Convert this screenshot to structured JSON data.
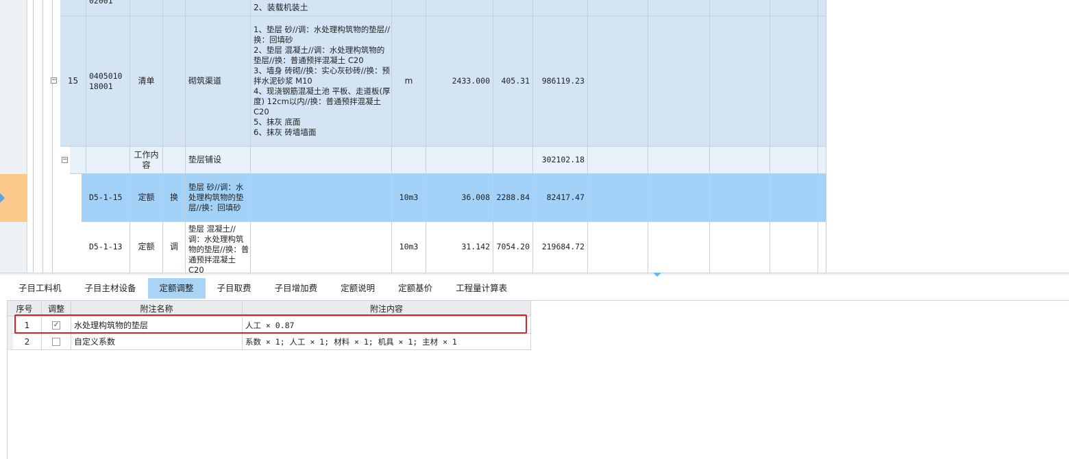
{
  "colors": {
    "row_list": "#d4e4f4",
    "row_work": "#e8f2fb",
    "row_selected": "#a3d2f9",
    "row_normal": "#ffffff",
    "left_selected": "#fcc98d",
    "highlight": "#e02020",
    "tab_active": "#a9d4f6"
  },
  "rows": [
    {
      "seq": "",
      "code": "02001",
      "type": "",
      "flag": "",
      "name": "",
      "desc": "2、装载机装土",
      "unit": "",
      "qty": "",
      "price": "",
      "total": ""
    },
    {
      "seq": "15",
      "code": "0405010\n18001",
      "type": "清单",
      "flag": "",
      "name": "砌筑渠道",
      "desc": "1、垫层 砂//调：水处理构筑物的垫层//换：回填砂\n2、垫层 混凝土//调：水处理构筑物的垫层//换：普通预拌混凝土 C20\n3、墙身 砖砌//换：实心灰砂砖//换：预拌水泥砂浆 M10\n4、现浇钢筋混凝土池 平板、走道板(厚度) 12cm以内//换：普通预拌混凝土 C20\n5、抹灰 底面\n6、抹灰 砖墙墙面",
      "unit": "m",
      "qty": "2433.000",
      "price": "405.31",
      "total": "986119.23"
    },
    {
      "seq": "",
      "code": "",
      "type": "工作内容",
      "flag": "",
      "name": "垫层铺设",
      "desc": "",
      "unit": "",
      "qty": "",
      "price": "",
      "total": "302102.18"
    },
    {
      "seq": "",
      "code": "D5-1-15",
      "type": "定额",
      "flag": "换",
      "name": "垫层 砂//调：水处理构筑物的垫层//换：回填砂",
      "desc": "",
      "unit": "10m3",
      "qty": "36.008",
      "price": "2288.84",
      "total": "82417.47"
    },
    {
      "seq": "",
      "code": "D5-1-13",
      "type": "定额",
      "flag": "调",
      "name": "垫层 混凝土//调：水处理构筑物的垫层//换：普通预拌混凝土 C20",
      "desc": "",
      "unit": "10m3",
      "qty": "31.142",
      "price": "7054.20",
      "total": "219684.72"
    }
  ],
  "tabs": [
    "子目工料机",
    "子目主材设备",
    "定额调整",
    "子目取费",
    "子目增加费",
    "定额说明",
    "定额基价",
    "工程量计算表"
  ],
  "active_tab": "定额调整",
  "adjust": {
    "headers": {
      "seq": "序号",
      "adjust": "调整",
      "name": "附注名称",
      "content": "附注内容"
    },
    "rows": [
      {
        "seq": "1",
        "checked": true,
        "name": "水处理构筑物的垫层",
        "content": "人工 × 0.87"
      },
      {
        "seq": "2",
        "checked": false,
        "name": "自定义系数",
        "content": "系数 × 1; 人工 × 1; 材料 × 1; 机具 × 1; 主材 × 1"
      }
    ]
  }
}
